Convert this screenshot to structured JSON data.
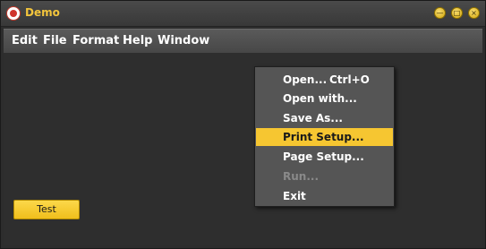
{
  "window": {
    "title": "Demo",
    "controls": [
      "minimize",
      "restore",
      "close"
    ]
  },
  "menubar": {
    "items": [
      "Edit",
      "File",
      "Format",
      "Help",
      "Window"
    ]
  },
  "dropdown": {
    "items": [
      {
        "label": "Open...",
        "shortcut": "Ctrl+O",
        "state": "normal"
      },
      {
        "label": "Open with...",
        "shortcut": "",
        "state": "normal"
      },
      {
        "label": "Save As...",
        "shortcut": "",
        "state": "normal"
      },
      {
        "label": "Print Setup...",
        "shortcut": "",
        "state": "highlighted"
      },
      {
        "label": "Page Setup...",
        "shortcut": "",
        "state": "normal"
      },
      {
        "label": "Run...",
        "shortcut": "",
        "state": "disabled"
      },
      {
        "label": "Exit",
        "shortcut": "",
        "state": "normal"
      }
    ]
  },
  "content": {
    "button_label": "Test"
  },
  "colors": {
    "accent": "#f6c631",
    "background": "#2e2e2e",
    "menu_bg": "#555555",
    "title_color": "#f3c53c"
  }
}
